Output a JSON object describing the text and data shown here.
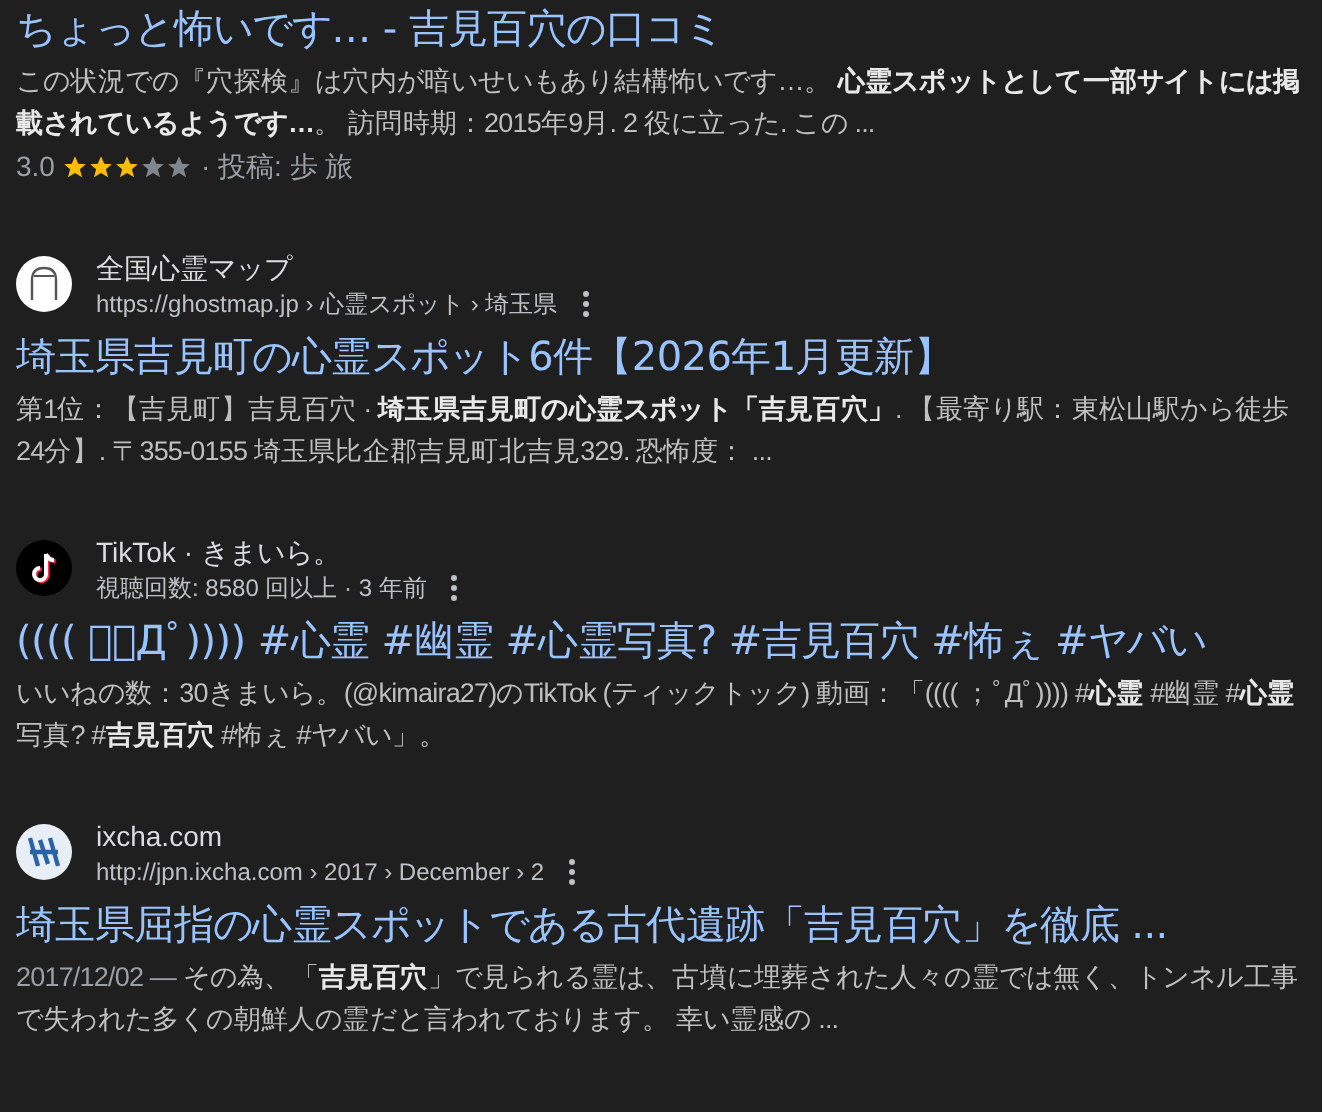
{
  "results": [
    {
      "title": "ちょっと怖いです… - 吉見百穴の口コミ",
      "snippet": "この状況での『穴探検』は穴内が暗いせいもあり結構怖いです…。 **心霊スポットとして一部サイトには掲載されているようです…**。 訪問時期：2015年9月. 2 役に立った. この ...",
      "rating": {
        "score": "3.0",
        "stars": 3,
        "author": "· 投稿: 歩 旅"
      }
    },
    {
      "site": {
        "kind": "ghost",
        "name": "全国心霊マップ",
        "url": "https://ghostmap.jp › 心霊スポット › 埼玉県"
      },
      "title": "埼玉県吉見町の心霊スポット6件【2026年1月更新】",
      "snippet": "第1位：【吉見町】吉見百穴 · **埼玉県吉見町の心霊スポット「吉見百穴」**. 【最寄り駅：東松山駅から徒歩24分】. 〒355-0155 埼玉県比企郡吉見町北吉見329. 恐怖度： ..."
    },
    {
      "site": {
        "kind": "tiktok",
        "name": "TikTok · きまいら。",
        "url": "視聴回数: 8580 回以上 · 3 年前"
      },
      "title": "(((( ；ﾟДﾟ)))) #心霊 #幽霊 #心霊写真? #吉見百穴 #怖ぇ #ヤバい",
      "snippet": "いいねの数：30きまいら。(@kimaira27)のTikTok (ティックトック) 動画：「(((( ；ﾟДﾟ)))) #**心霊** #幽霊 #**心霊**写真? #**吉見百穴** #怖ぇ #ヤバい」。"
    },
    {
      "site": {
        "kind": "ixcha",
        "name": "ixcha.com",
        "url": "http://jpn.ixcha.com › 2017 › December › 2"
      },
      "title": "埼玉県屈指の心霊スポットである古代遺跡「吉見百穴」を徹底 ...",
      "date": "2017/12/02 —",
      "snippet": "その為、「**吉見百穴**」で見られる霊は、古墳に埋葬された人々の霊では無く、トンネル工事で失われた多くの朝鮮人の霊だと言われております。 幸い霊感の ..."
    }
  ]
}
